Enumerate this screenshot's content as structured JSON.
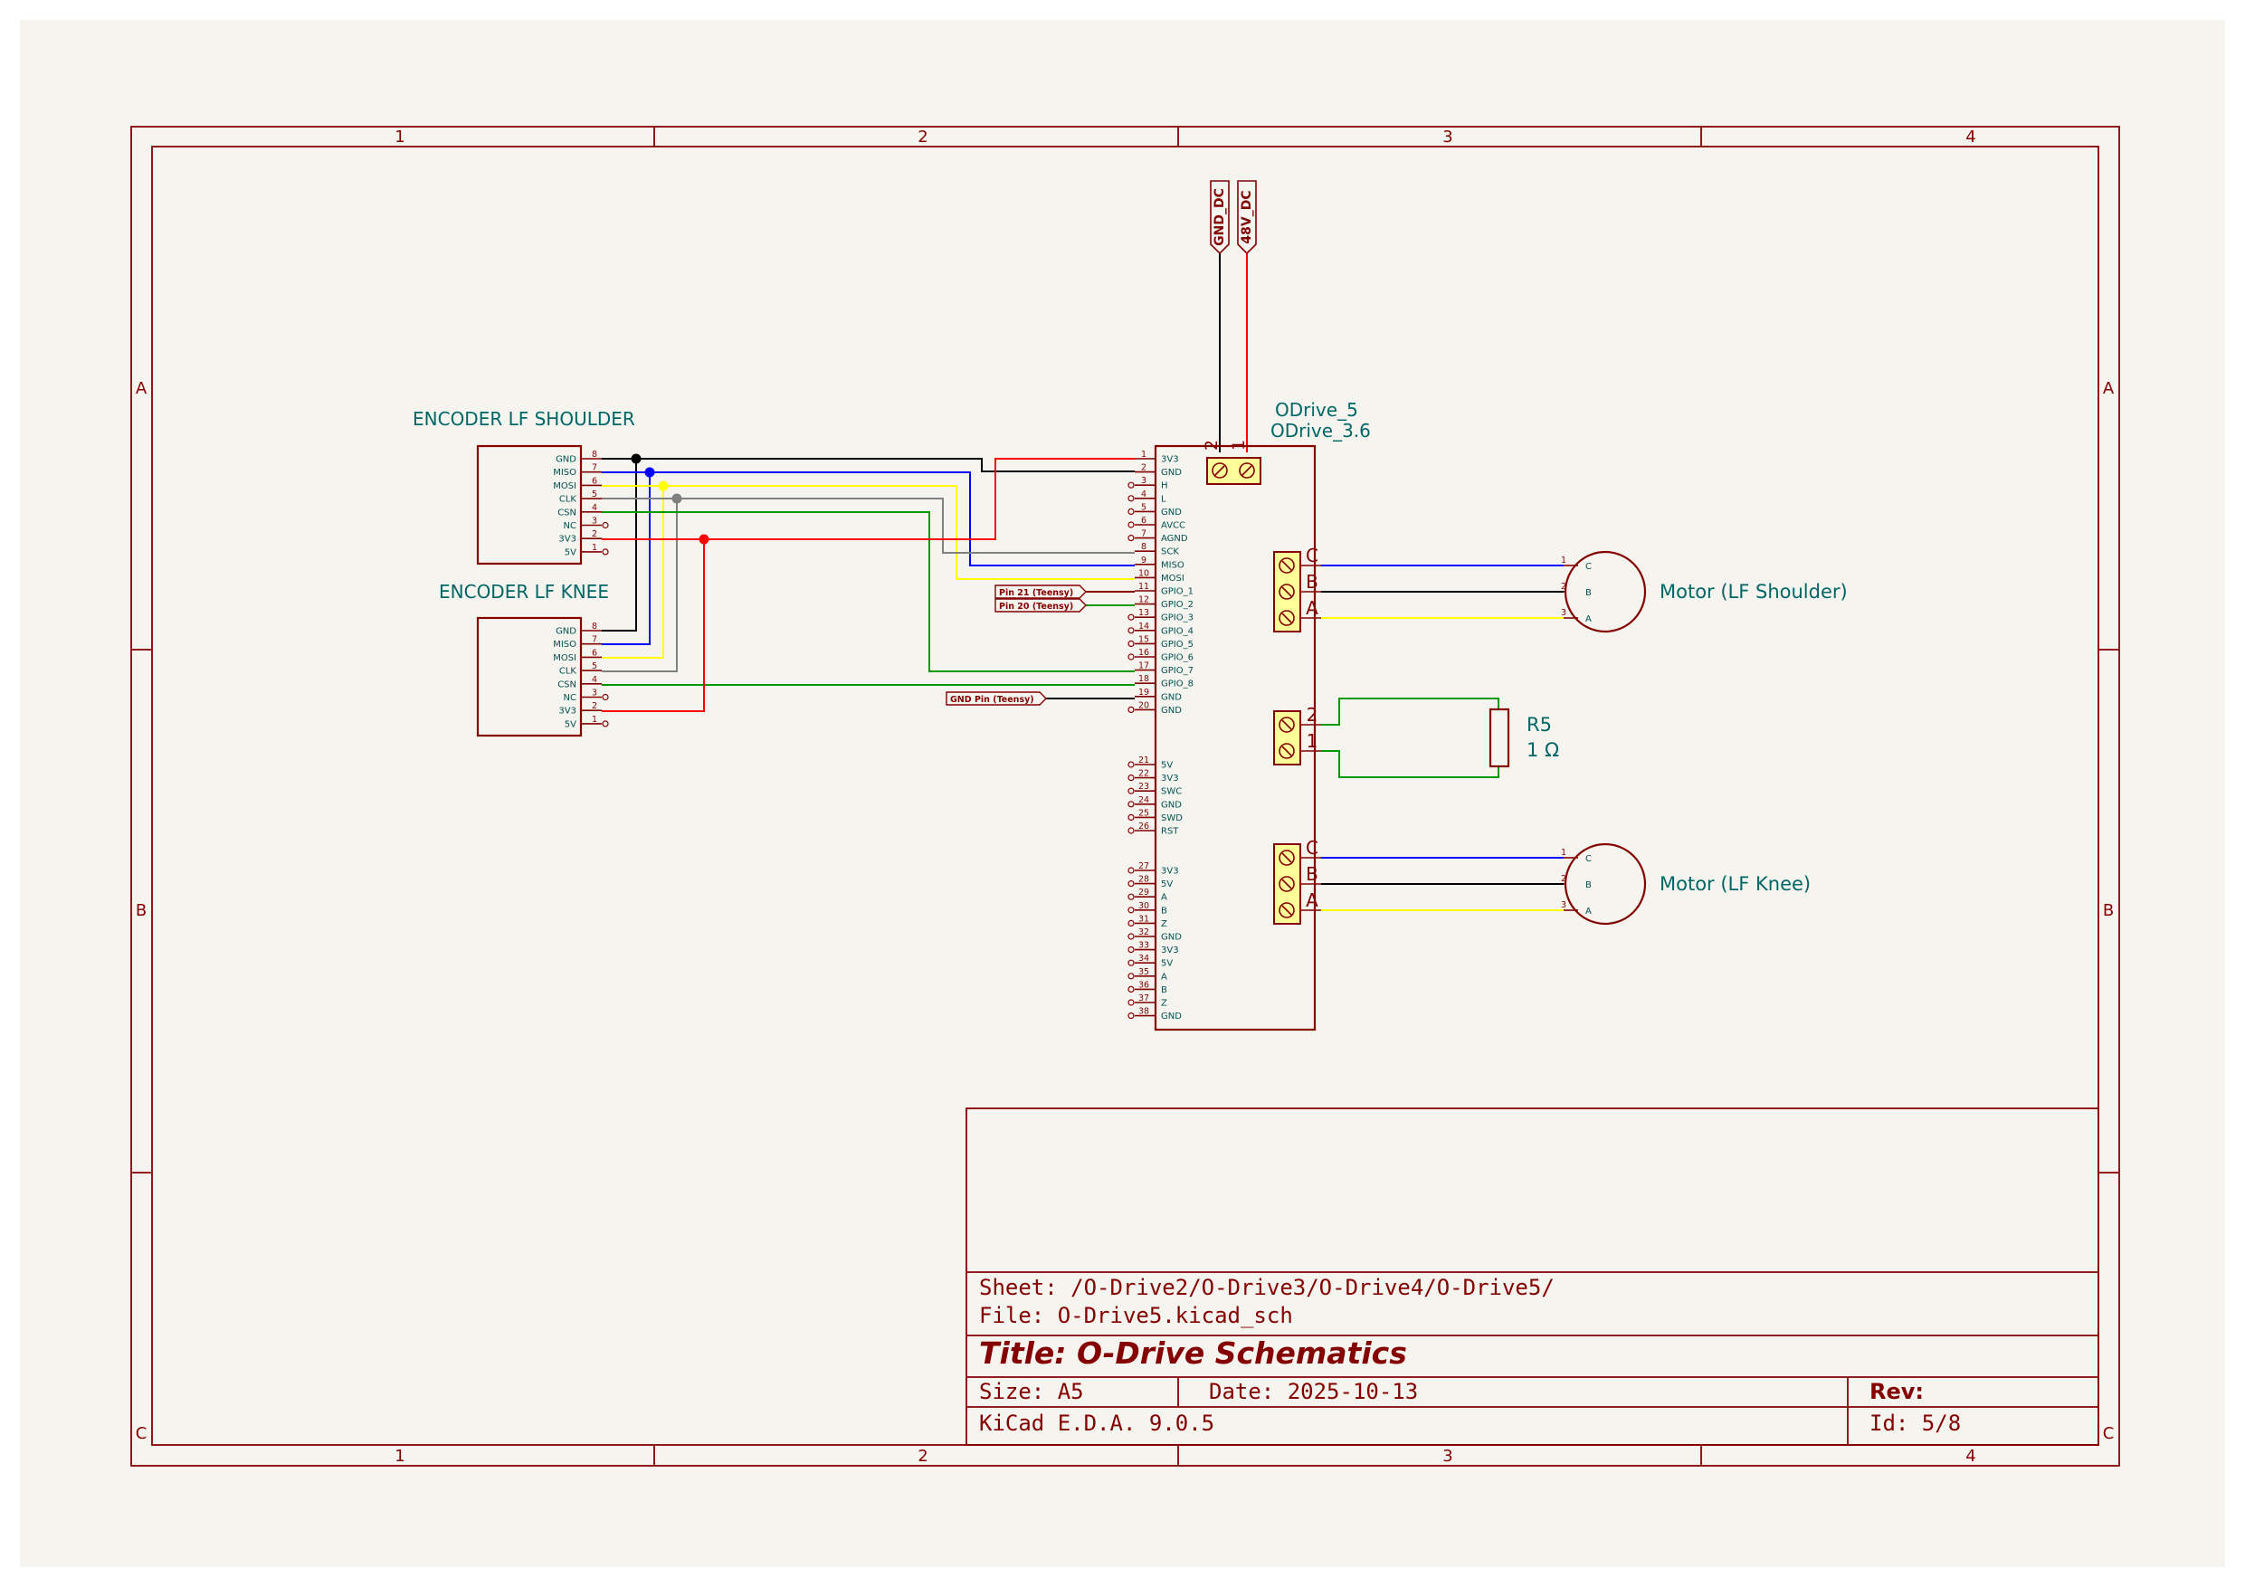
{
  "frame": {
    "columns": [
      "1",
      "2",
      "3",
      "4"
    ],
    "rows": [
      "A",
      "B",
      "C"
    ]
  },
  "power_labels": {
    "gnd": "GND_DC",
    "v48": "48V_DC"
  },
  "encoders": {
    "shoulder": {
      "label": "ENCODER LF SHOULDER",
      "pins": [
        {
          "name": "GND",
          "num": "8"
        },
        {
          "name": "MISO",
          "num": "7"
        },
        {
          "name": "MOSI",
          "num": "6"
        },
        {
          "name": "CLK",
          "num": "5"
        },
        {
          "name": "CSN",
          "num": "4"
        },
        {
          "name": "NC",
          "num": "3"
        },
        {
          "name": "3V3",
          "num": "2"
        },
        {
          "name": "5V",
          "num": "1"
        }
      ]
    },
    "knee": {
      "label": "ENCODER LF KNEE",
      "pins": [
        {
          "name": "GND",
          "num": "8"
        },
        {
          "name": "MISO",
          "num": "7"
        },
        {
          "name": "MOSI",
          "num": "6"
        },
        {
          "name": "CLK",
          "num": "5"
        },
        {
          "name": "CSN",
          "num": "4"
        },
        {
          "name": "NC",
          "num": "3"
        },
        {
          "name": "3V3",
          "num": "2"
        },
        {
          "name": "5V",
          "num": "1"
        }
      ]
    }
  },
  "odrive": {
    "ref": "ODrive_5",
    "value": "ODrive_3.6",
    "power_pins": [
      "2",
      "1"
    ],
    "pins": [
      {
        "num": "1",
        "name": "3V3"
      },
      {
        "num": "2",
        "name": "GND"
      },
      {
        "num": "3",
        "name": "H"
      },
      {
        "num": "4",
        "name": "L"
      },
      {
        "num": "5",
        "name": "GND"
      },
      {
        "num": "6",
        "name": "AVCC"
      },
      {
        "num": "7",
        "name": "AGND"
      },
      {
        "num": "8",
        "name": "SCK"
      },
      {
        "num": "9",
        "name": "MISO"
      },
      {
        "num": "10",
        "name": "MOSI"
      },
      {
        "num": "11",
        "name": "GPIO_1"
      },
      {
        "num": "12",
        "name": "GPIO_2"
      },
      {
        "num": "13",
        "name": "GPIO_3"
      },
      {
        "num": "14",
        "name": "GPIO_4"
      },
      {
        "num": "15",
        "name": "GPIO_5"
      },
      {
        "num": "16",
        "name": "GPIO_6"
      },
      {
        "num": "17",
        "name": "GPIO_7"
      },
      {
        "num": "18",
        "name": "GPIO_8"
      },
      {
        "num": "19",
        "name": "GND"
      },
      {
        "num": "20",
        "name": "GND"
      },
      {
        "num": "21",
        "name": "5V"
      },
      {
        "num": "22",
        "name": "3V3"
      },
      {
        "num": "23",
        "name": "SWC"
      },
      {
        "num": "24",
        "name": "GND"
      },
      {
        "num": "25",
        "name": "SWD"
      },
      {
        "num": "26",
        "name": "RST"
      },
      {
        "num": "27",
        "name": "3V3"
      },
      {
        "num": "28",
        "name": "5V"
      },
      {
        "num": "29",
        "name": "A"
      },
      {
        "num": "30",
        "name": "B"
      },
      {
        "num": "31",
        "name": "Z"
      },
      {
        "num": "32",
        "name": "GND"
      },
      {
        "num": "33",
        "name": "3V3"
      },
      {
        "num": "34",
        "name": "5V"
      },
      {
        "num": "35",
        "name": "A"
      },
      {
        "num": "36",
        "name": "B"
      },
      {
        "num": "37",
        "name": "Z"
      },
      {
        "num": "38",
        "name": "GND"
      }
    ],
    "motor_terminals": [
      "C",
      "B",
      "A"
    ],
    "resistor_terminals": [
      "2",
      "1"
    ]
  },
  "teensy_labels": {
    "pin21": "Pin 21 (Teensy)",
    "pin20": "Pin 20 (Teensy)",
    "gnd": "GND Pin (Teensy)"
  },
  "motors": {
    "shoulder": {
      "label": "Motor (LF Shoulder)",
      "pins": [
        "1",
        "2",
        "3"
      ],
      "phases": [
        "C",
        "B",
        "A"
      ]
    },
    "knee": {
      "label": "Motor (LF Knee)",
      "pins": [
        "1",
        "2",
        "3"
      ],
      "phases": [
        "C",
        "B",
        "A"
      ]
    }
  },
  "resistor": {
    "ref": "R5",
    "value": "1 Ω"
  },
  "title_block": {
    "sheet": "Sheet: /O-Drive2/O-Drive3/O-Drive4/O-Drive5/",
    "file": "File: O-Drive5.kicad_sch",
    "title": "Title: O-Drive Schematics",
    "size": "Size: A5",
    "date": "Date: 2025-10-13",
    "rev": "Rev:",
    "tool": "KiCad E.D.A. 9.0.5",
    "id": "Id: 5/8"
  },
  "colors": {
    "outline": "#840000",
    "label": "#006666",
    "wire_gnd": "#000000",
    "wire_miso": "#0000ff",
    "wire_mosi": "#ffff00",
    "wire_clk": "#808080",
    "wire_csn": "#009900",
    "wire_3v3": "#ff0000"
  }
}
